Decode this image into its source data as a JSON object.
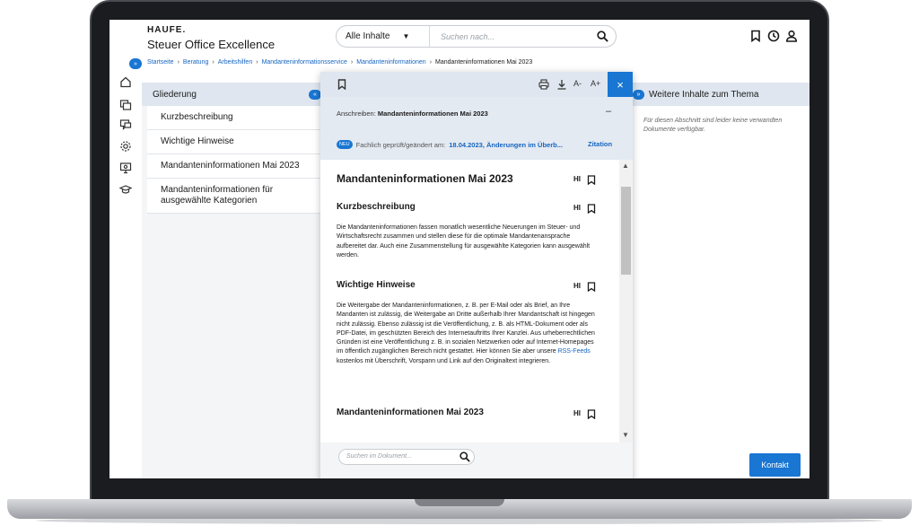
{
  "header": {
    "logo": "HAUFE.",
    "app_title": "Steuer Office Excellence",
    "search_scope": "Alle Inhalte",
    "search_placeholder": "Suchen nach..."
  },
  "breadcrumb": {
    "toggle": "»",
    "items": [
      "Startseite",
      "Beratung",
      "Arbeitshilfen",
      "Mandanteninformationsservice",
      "Mandanteninformationen"
    ],
    "current": "Mandanteninformationen Mai 2023"
  },
  "outline": {
    "title": "Gliederung",
    "collapse": "«",
    "items": [
      "Kurzbeschreibung",
      "Wichtige Hinweise",
      "Mandanteninformationen Mai 2023",
      "Mandanteninformationen für ausgewählte Kategorien"
    ]
  },
  "related": {
    "title": "Weitere Inhalte zum Thema",
    "expand": "»",
    "message": "Für diesen Abschnitt sind leider keine verwandten Dokumente verfügbar."
  },
  "contact_button": "Kontakt",
  "document": {
    "toolbar": {
      "font_smaller": "A-",
      "font_larger": "A+",
      "close": "×"
    },
    "meta": {
      "label": "Anschreiben:",
      "title": "Mandanteninformationen Mai 2023",
      "collapse": "–",
      "badge": "NEU",
      "checked_label": "Fachlich geprüft/geändert am:",
      "checked_value": "18.04.2023, Änderungen im Überb...",
      "citation": "Zitation"
    },
    "main_title": "Mandanteninformationen Mai 2023",
    "hi": "HI",
    "sections": [
      {
        "heading": "Kurzbeschreibung",
        "text": "Die Mandanteninformationen fassen monatlich wesentliche Neuerungen im Steuer- und Wirtschaftsrecht zusammen und stellen diese für die optimale Mandantenansprache aufbereitet dar. Auch eine Zusammenstellung für ausgewählte Kategorien kann ausgewählt werden."
      },
      {
        "heading": "Wichtige Hinweise",
        "text_before_link": "Die Weitergabe der Mandanteninformationen, z. B. per E-Mail oder als Brief, an Ihre Mandanten ist zulässig, die Weitergabe an Dritte außerhalb Ihrer Mandantschaft ist hingegen nicht zulässig. Ebenso zulässig ist die Veröffentlichung, z. B. als HTML-Dokument oder als PDF-Datei, im geschützten Bereich des Internetauftritts Ihrer Kanzlei. Aus urheberrechtlichen Gründen ist eine Veröffentlichung z. B. in sozialen Netzwerken oder auf Internet-Homepages im öffentlich zugänglichen Bereich nicht gestattet. Hier können Sie aber unsere ",
        "link": "RSS-Feeds",
        "text_after_link": " kostenlos mit Überschrift, Vorspann und Link auf den Originaltext integrieren."
      },
      {
        "heading": "Mandanteninformationen Mai 2023"
      }
    ],
    "search_placeholder": "Suchen im Dokument..."
  },
  "colors": {
    "accent": "#1976d2",
    "panel_header": "#dfe6ef",
    "link": "#1565c0"
  }
}
